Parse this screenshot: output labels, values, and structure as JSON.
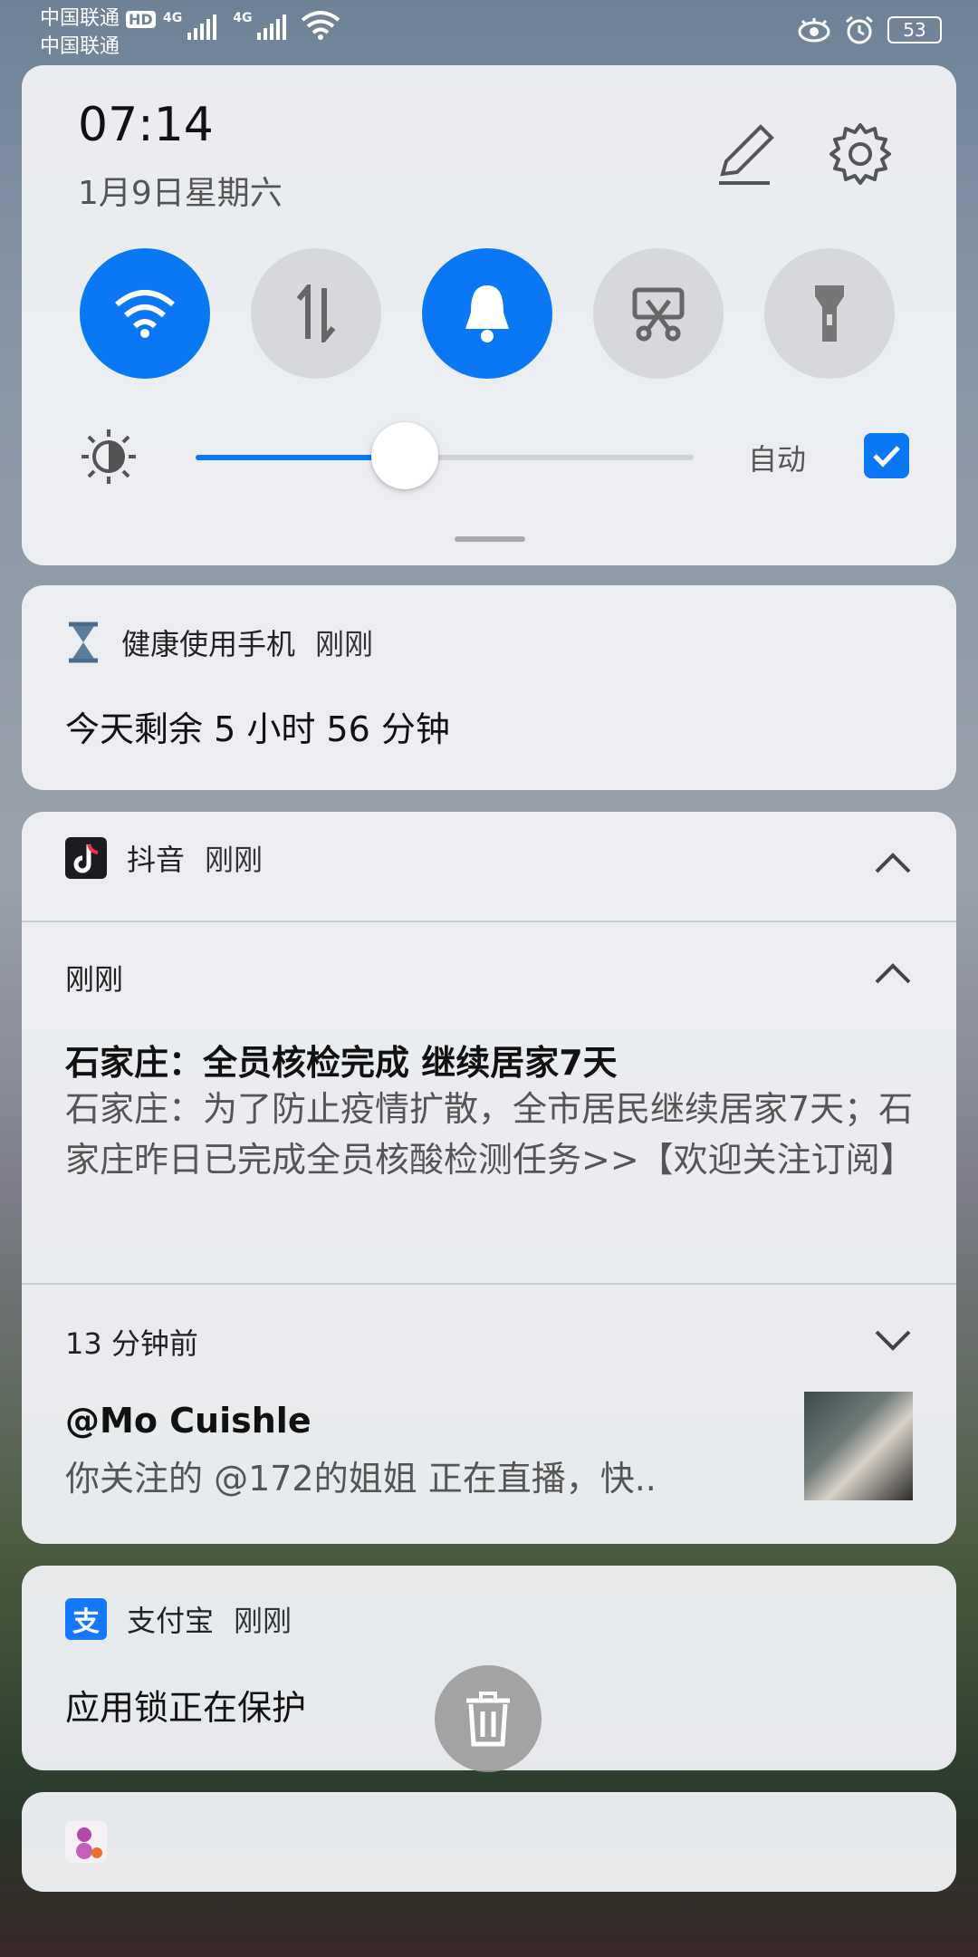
{
  "status_bar": {
    "carrier_1": "中国联通",
    "carrier_hd": "HD",
    "carrier_2": "中国联通",
    "net_1": "4G",
    "net_2": "4G",
    "battery": "53"
  },
  "quick_settings": {
    "time": "07:14",
    "date": "1月9日星期六",
    "brightness_level": 0.42,
    "auto_label": "自动",
    "auto_checked": true,
    "tiles": [
      {
        "name": "wifi",
        "on": true
      },
      {
        "name": "mobile-data",
        "on": false
      },
      {
        "name": "sound",
        "on": true
      },
      {
        "name": "screenshot",
        "on": false
      },
      {
        "name": "flashlight",
        "on": false
      }
    ],
    "accent": "#0a78f5"
  },
  "notifications": {
    "health": {
      "app": "健康使用手机",
      "time": "刚刚",
      "body": "今天剩余 5 小时 56 分钟"
    },
    "douyin": {
      "app": "抖音",
      "time": "刚刚",
      "group_1": {
        "time": "刚刚",
        "title": "石家庄：全员核检完成 继续居家7天",
        "text": "石家庄：为了防止疫情扩散，全市居民继续居家7天；石家庄昨日已完成全员核酸检测任务>>【欢迎关注订阅】"
      },
      "group_2": {
        "time": "13 分钟前",
        "title": "@Mo Cuishle",
        "text": "你关注的 @172的姐姐 正在直播，快.."
      }
    },
    "alipay": {
      "app": "支付宝",
      "time": "刚刚",
      "body": "应用锁正在保护"
    }
  }
}
